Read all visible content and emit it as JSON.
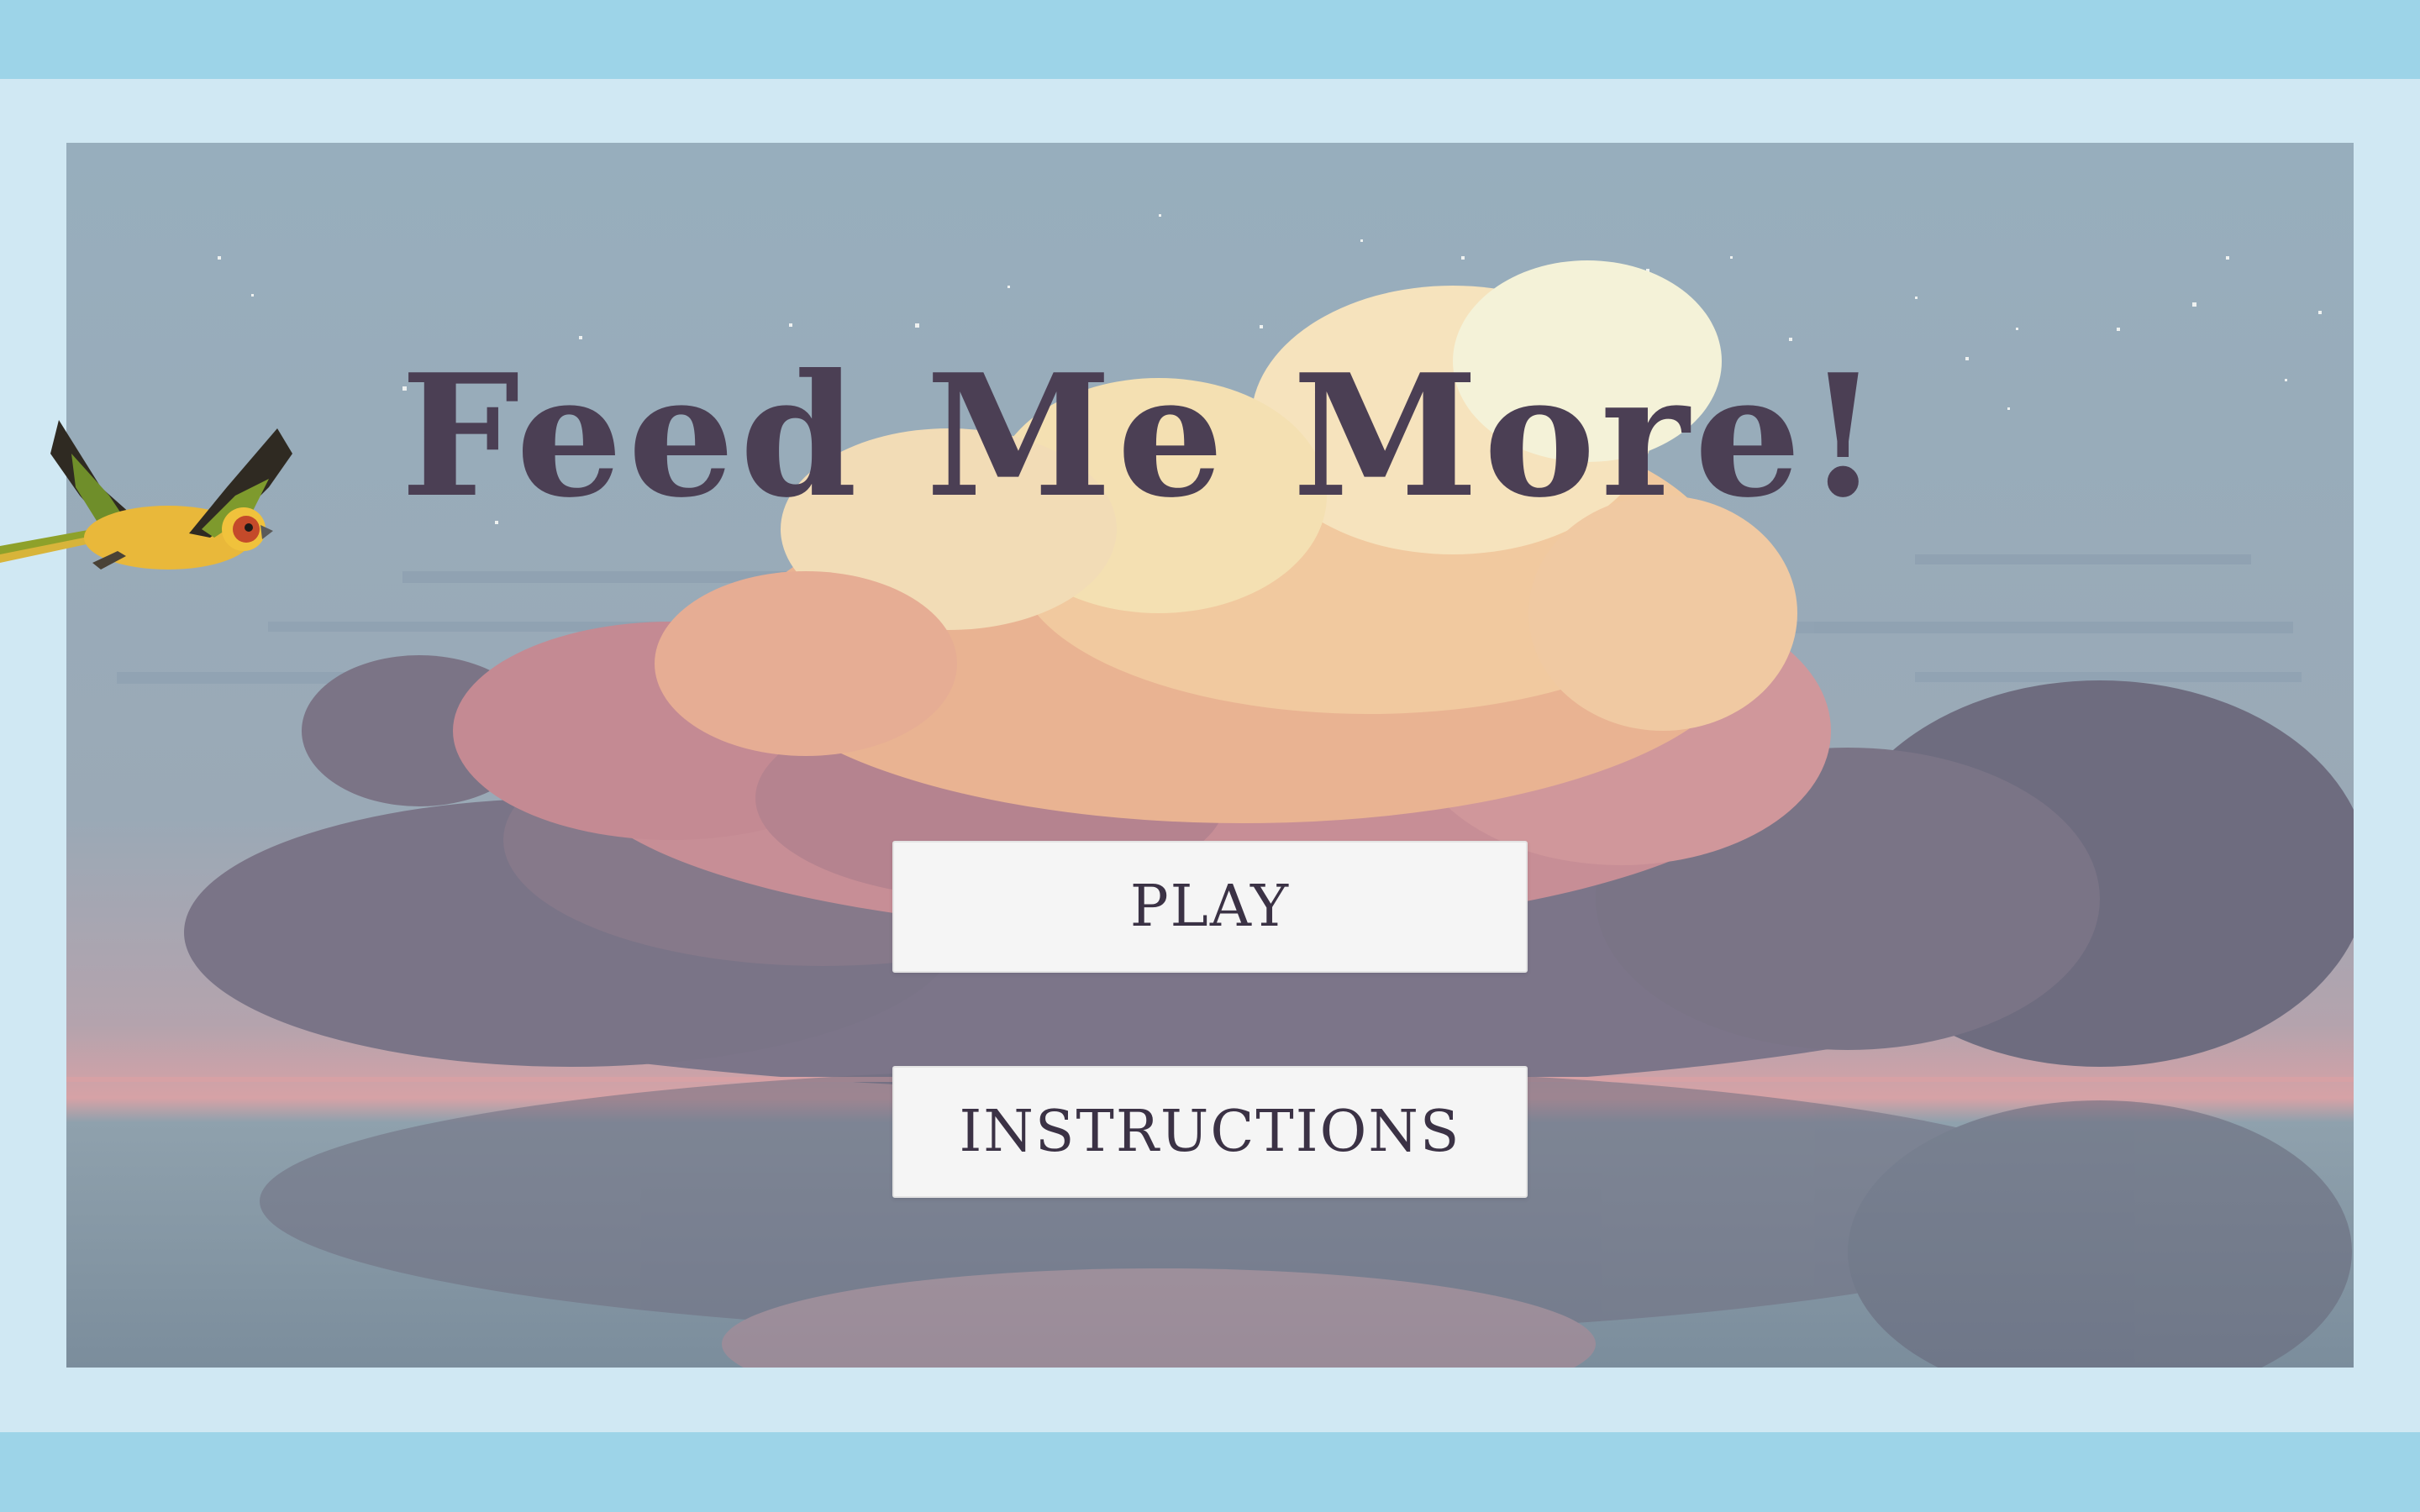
{
  "game": {
    "title": "Feed Me More!",
    "menu": {
      "play_label": "PLAY",
      "instructions_label": "INSTRUCTIONS"
    },
    "sprite": "parrot-sprite",
    "background": "pixel-art-sunset-clouds-over-water"
  },
  "colors": {
    "outer_band": "#9dd4e8",
    "frame": "#d0e8f3",
    "sky": "#98adbb",
    "title": "#4b3f54",
    "button_bg": "#f5f5f5",
    "button_text": "#3b3245"
  }
}
